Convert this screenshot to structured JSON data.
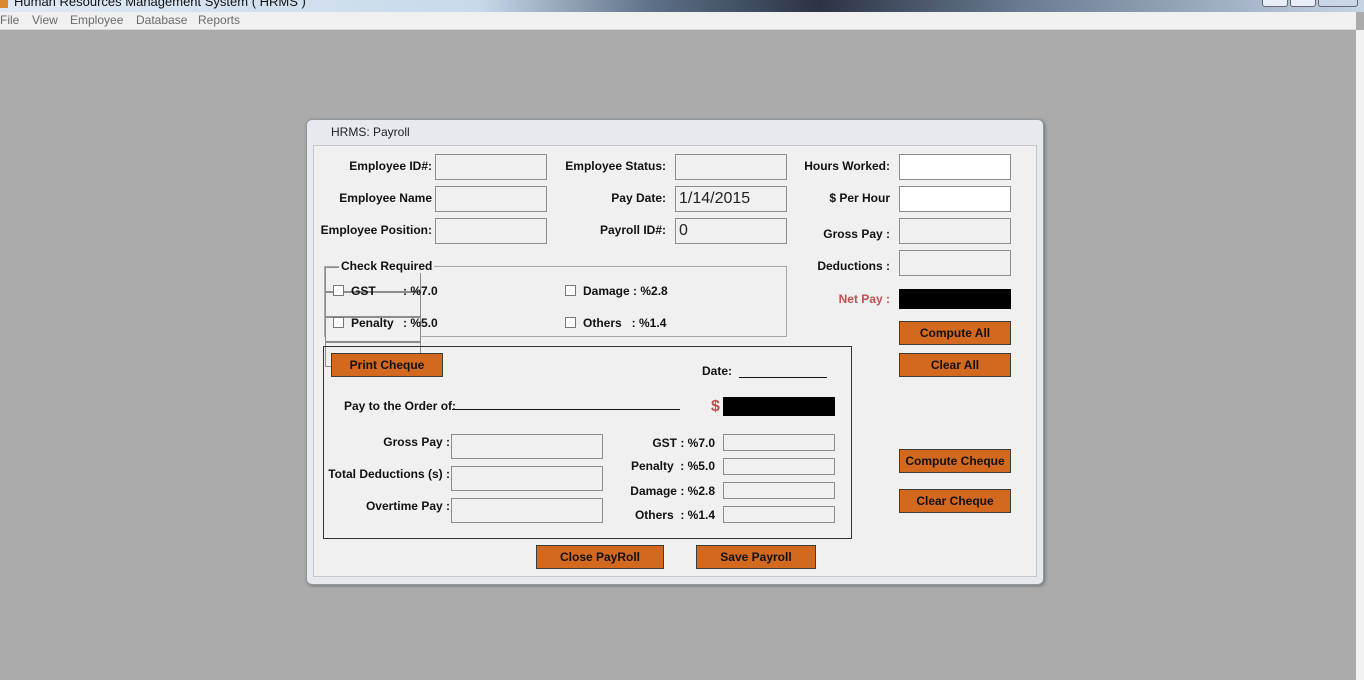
{
  "app": {
    "title": "Human Resources Management System ( HRMS )",
    "menu": [
      "File",
      "View",
      "Employee",
      "Database",
      "Reports"
    ]
  },
  "window": {
    "title": "HRMS: Payroll"
  },
  "employee": {
    "id_label": "Employee ID#:",
    "name_label": "Employee Name",
    "position_label": "Employee Position:",
    "status_label": "Employee Status:",
    "pay_date_label": "Pay Date:",
    "pay_date_value": "1/14/2015",
    "payroll_id_label": "Payroll ID#:",
    "payroll_id_value": "0"
  },
  "pay": {
    "hours_label": "Hours Worked:",
    "rate_label": "$ Per Hour",
    "gross_label": "Gross Pay :",
    "deductions_label": "Deductions :",
    "net_label": "Net Pay :",
    "net_color": "#c0504d"
  },
  "checks": {
    "group_title": "Check Required",
    "gst_label": "GST",
    "gst_rate": ": %7.0",
    "penalty_label": "Penalty",
    "penalty_rate": ": %5.0",
    "damage_label": "Damage : %2.8",
    "others_label": "Others   : %1.4"
  },
  "cheque": {
    "print_button": "Print Cheque",
    "date_label": "Date:",
    "pay_to_label": "Pay to the Order of:",
    "dollar_sign": "$",
    "gross_label": "Gross Pay :",
    "total_deductions_label": "Total Deductions (s) :",
    "overtime_label": "Overtime Pay :",
    "gst_label": "GST : %7.0",
    "penalty_label": "Penalty  : %5.0",
    "damage_label": "Damage : %2.8",
    "others_label": "Others  : %1.4"
  },
  "buttons": {
    "compute_all": "Compute All",
    "clear_all": "Clear All",
    "compute_cheque": "Compute Cheque",
    "clear_cheque": "Clear Cheque",
    "close_payroll": "Close PayRoll",
    "save_payroll": "Save Payroll"
  },
  "colors": {
    "button": "#d2691e",
    "desktop": "#ababab"
  }
}
